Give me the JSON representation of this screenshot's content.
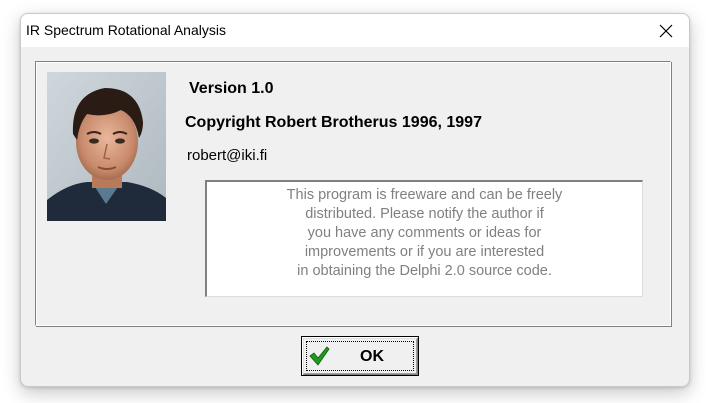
{
  "window": {
    "title": "IR Spectrum Rotational Analysis"
  },
  "about": {
    "version": "Version 1.0",
    "copyright": "Copyright Robert Brotherus 1996, 1997",
    "email": "robert@iki.fi",
    "description_lines": [
      "This program is freeware and can be freely",
      "distributed. Please notify the author if",
      "you have any comments or ideas for",
      "improvements or if you are interested",
      "in obtaining the Delphi 2.0 source code."
    ]
  },
  "buttons": {
    "ok_label": "OK"
  },
  "icons": {
    "close": "close-icon",
    "ok_check": "checkmark-icon",
    "photo": "author-photo"
  },
  "colors": {
    "dialog_bg": "#f0f0f0",
    "memo_text": "#808080",
    "check_green": "#1f9a1f"
  }
}
